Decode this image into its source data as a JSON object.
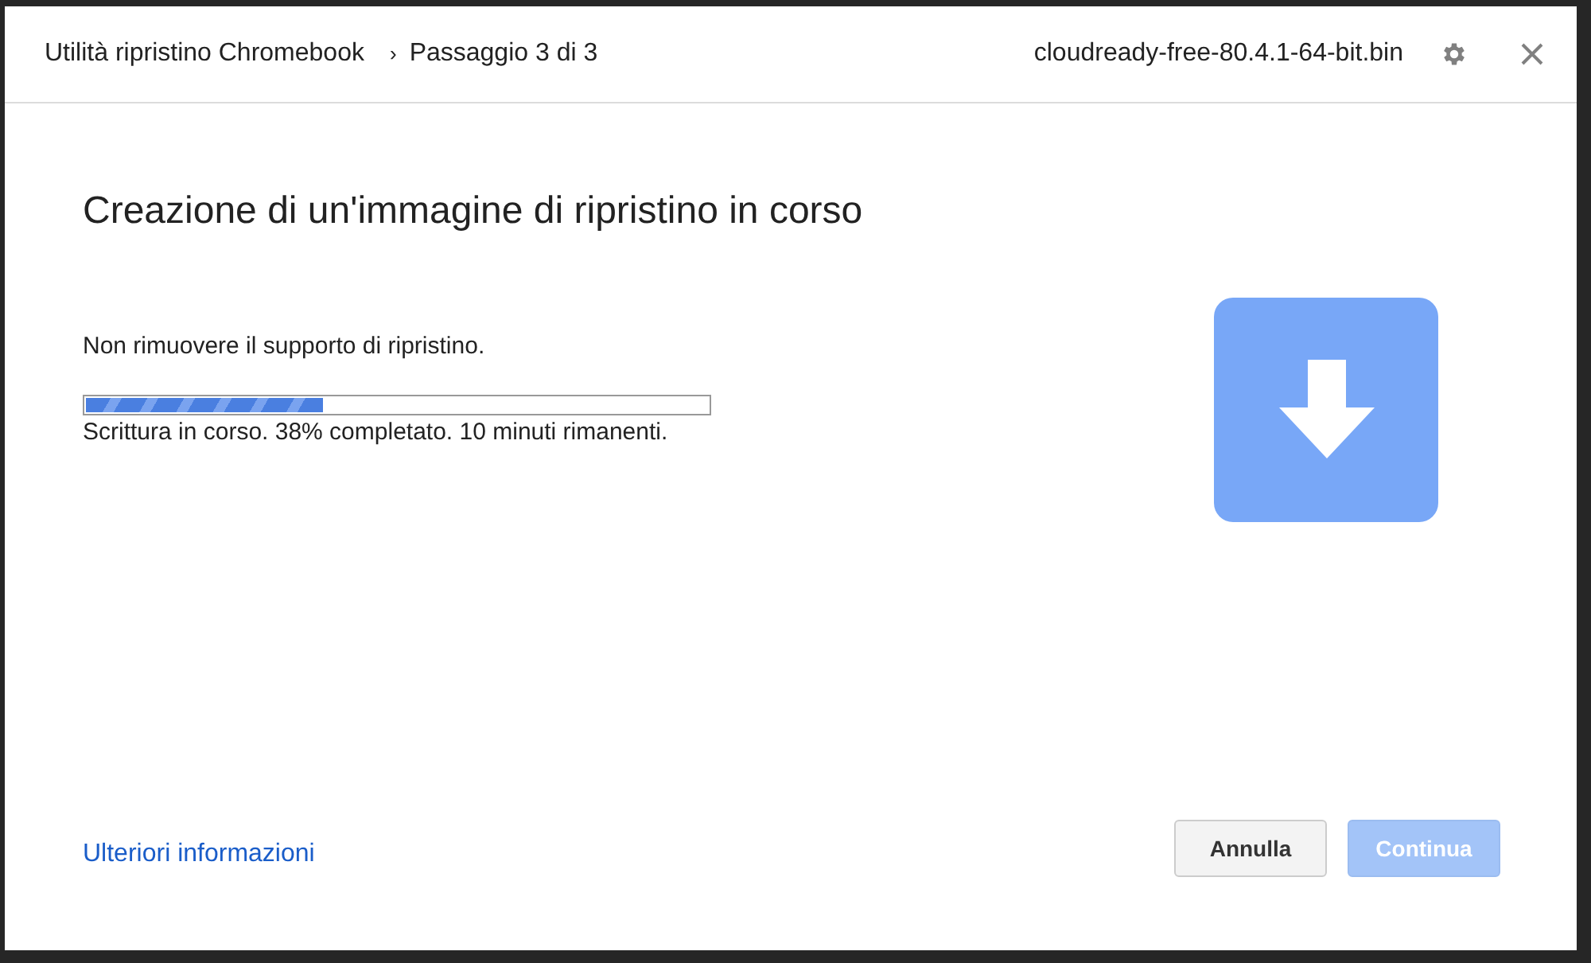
{
  "window": {
    "app_title": "Utilità ripristino Chromebook",
    "separator": "›",
    "step": "Passaggio 3 di 3",
    "file_name": "cloudready-free-80.4.1-64-bit.bin"
  },
  "heading": "Creazione di un'immagine di ripristino in corso",
  "warning": "Non rimuovere il supporto di ripristino.",
  "progress": {
    "level": 0.38,
    "status": "Scrittura in corso. 38% completato. 10 minuti rimanenti."
  },
  "link": "Ulteriori informazioni",
  "buttons": [
    {
      "label": "Annulla",
      "disabled": false
    },
    {
      "label": "Continua",
      "disabled": true
    }
  ]
}
